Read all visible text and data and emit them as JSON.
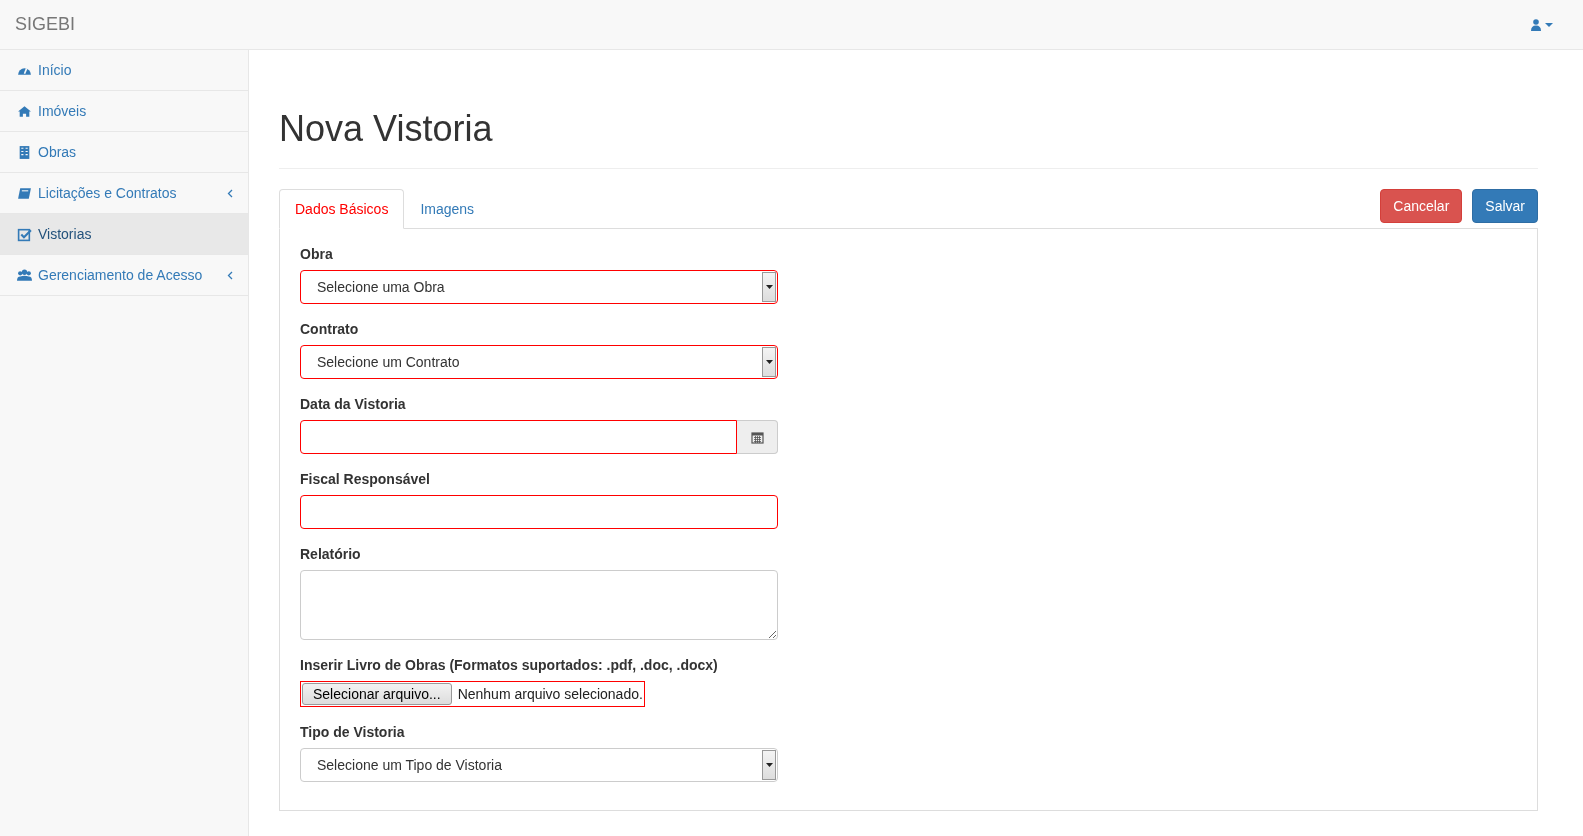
{
  "navbar": {
    "brand": "SIGEBI"
  },
  "sidebar": {
    "items": [
      {
        "label": "Início",
        "selected": false,
        "expandable": false
      },
      {
        "label": "Imóveis",
        "selected": false,
        "expandable": false
      },
      {
        "label": "Obras",
        "selected": false,
        "expandable": false
      },
      {
        "label": "Licitações e Contratos",
        "selected": false,
        "expandable": true
      },
      {
        "label": "Vistorias",
        "selected": true,
        "expandable": false
      },
      {
        "label": "Gerenciamento de Acesso",
        "selected": false,
        "expandable": true
      }
    ]
  },
  "page": {
    "title": "Nova Vistoria"
  },
  "tabs": [
    {
      "label": "Dados Básicos",
      "selected": true
    },
    {
      "label": "Imagens",
      "selected": false
    }
  ],
  "buttons": [
    {
      "label": "Cancelar",
      "kind": "danger"
    },
    {
      "label": "Salvar",
      "kind": "primary"
    }
  ],
  "fields": [
    {
      "kind": "select",
      "label": "Obra",
      "value": "Selecione uma Obra",
      "invalid": true
    },
    {
      "kind": "select",
      "label": "Contrato",
      "value": "Selecione um Contrato",
      "invalid": true
    },
    {
      "kind": "date",
      "label": "Data da Vistoria",
      "invalid": true
    },
    {
      "kind": "text",
      "label": "Fiscal Responsável",
      "invalid": true
    },
    {
      "kind": "textarea",
      "label": "Relatório",
      "invalid": false
    },
    {
      "kind": "file",
      "label": "Inserir Livro de Obras (Formatos suportados: .pdf, .doc, .docx)",
      "button": "Selecionar arquivo...",
      "status": "Nenhum arquivo selecionado.",
      "invalid": true
    },
    {
      "kind": "select",
      "label": "Tipo de Vistoria",
      "value": "Selecione um Tipo de Vistoria",
      "invalid": false
    }
  ]
}
